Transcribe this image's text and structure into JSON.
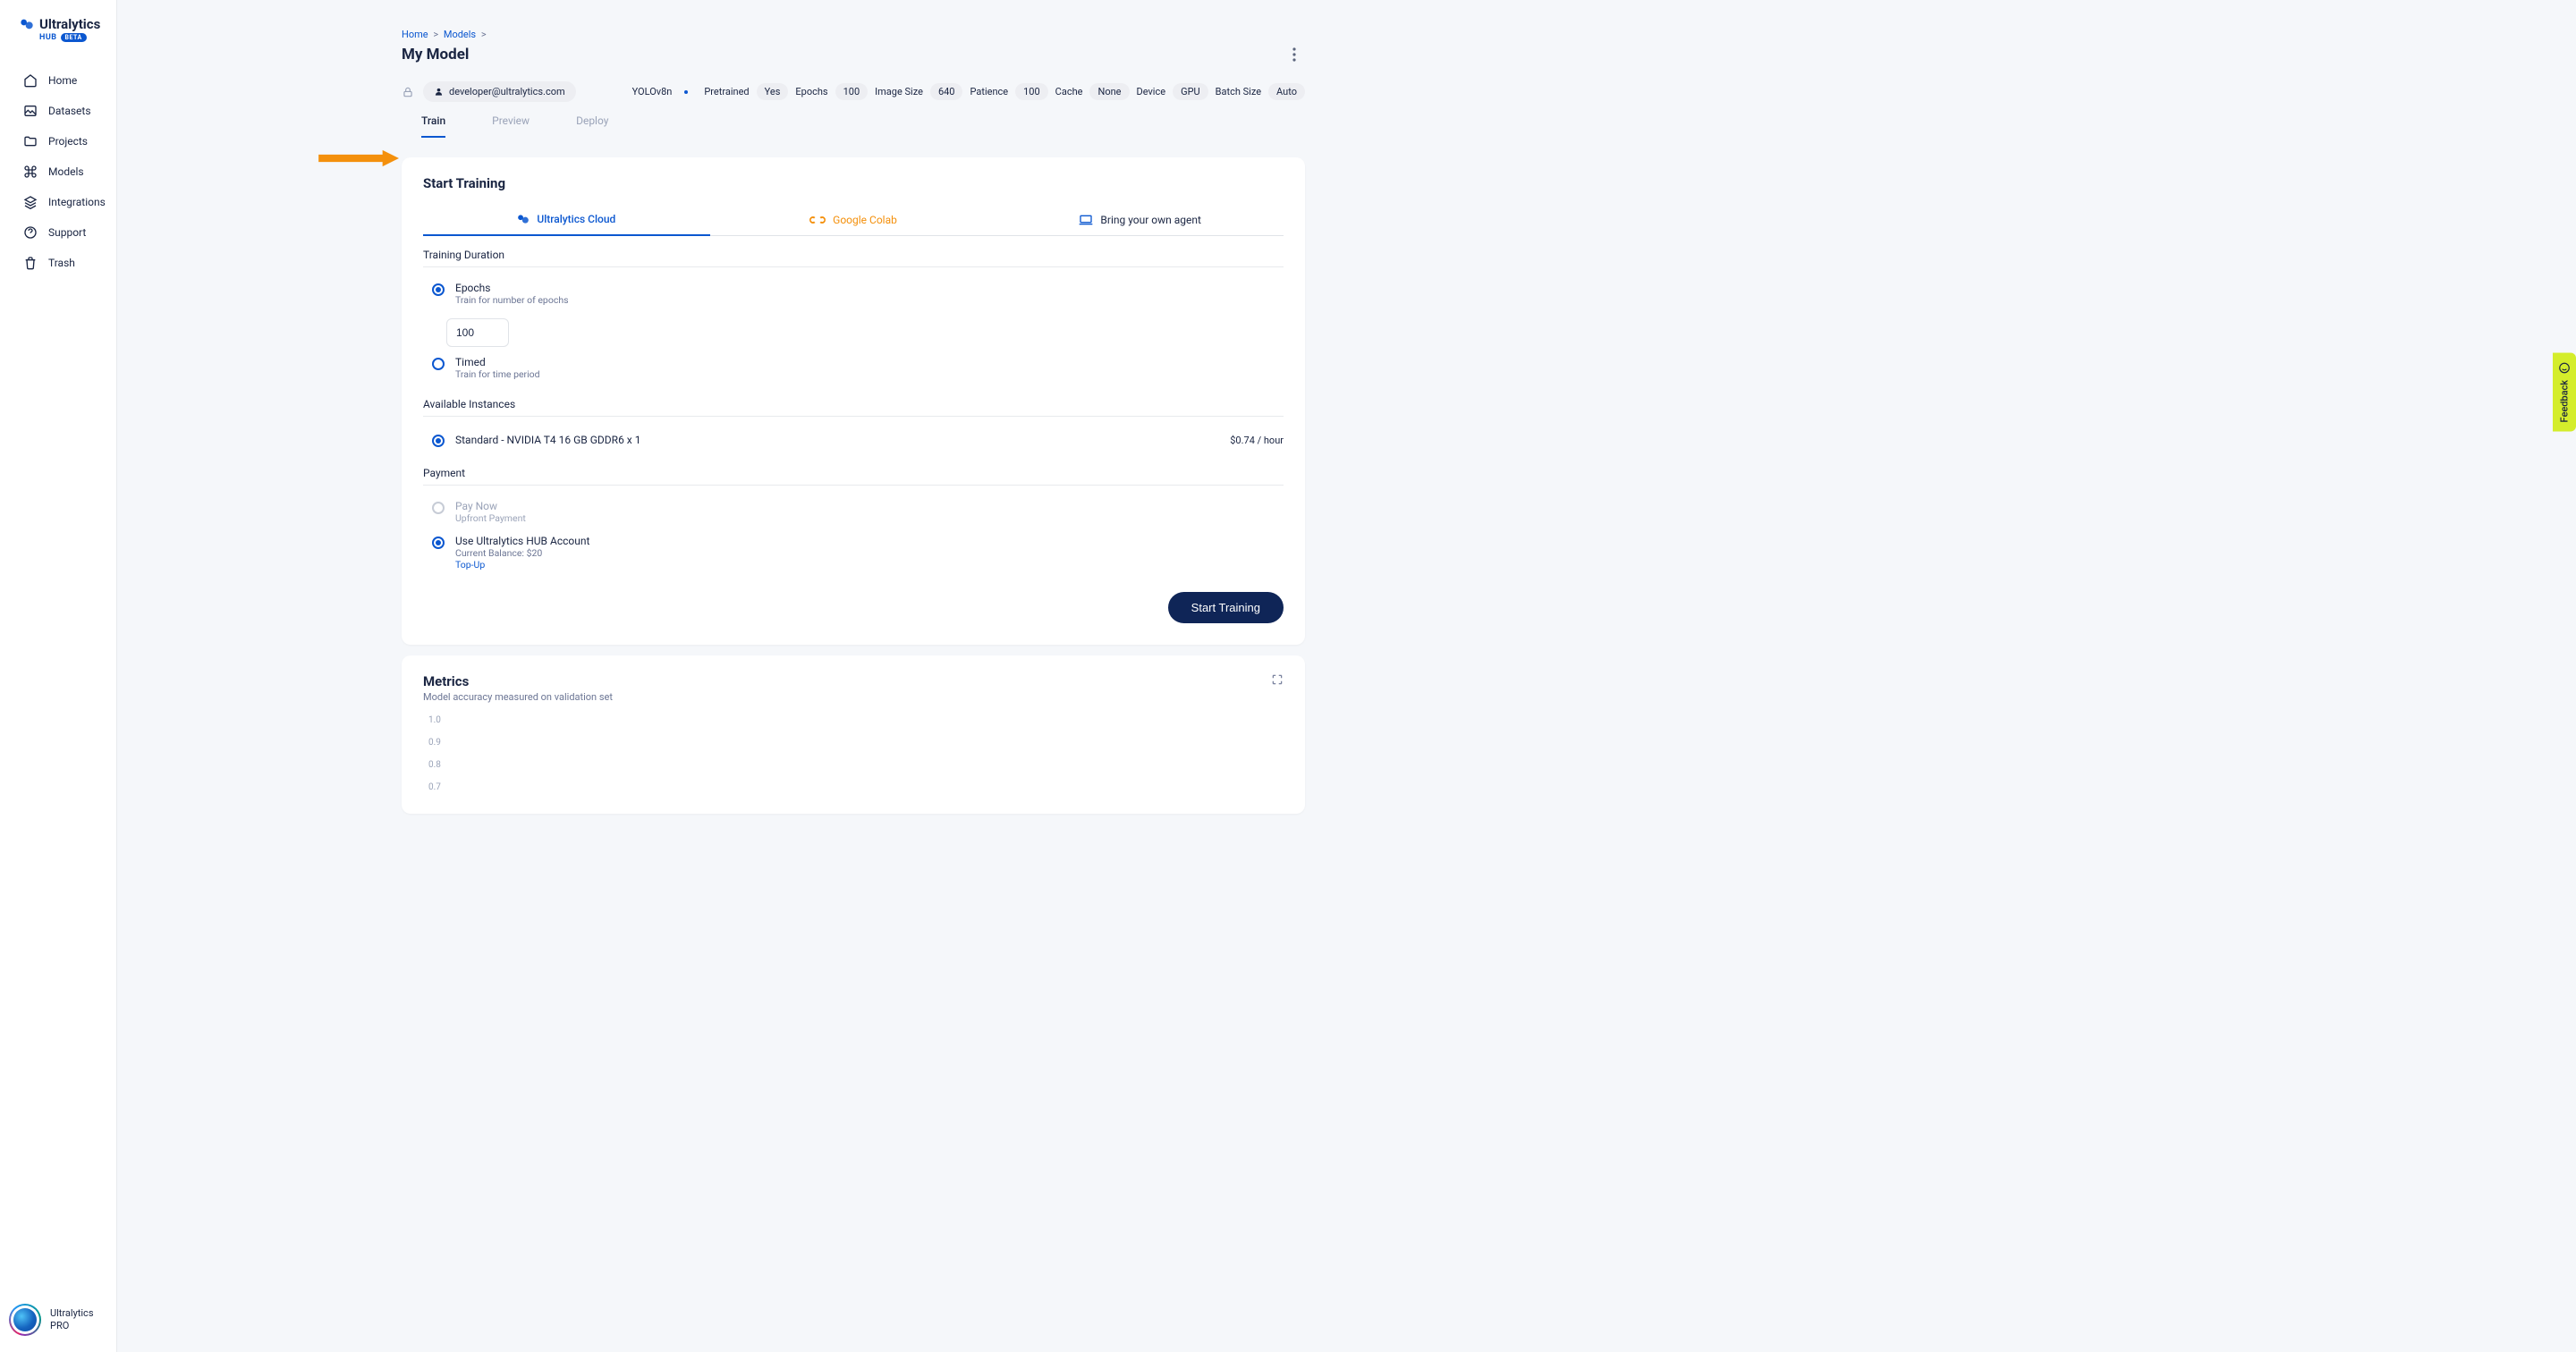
{
  "brand": {
    "name": "Ultralytics",
    "sub1": "HUB",
    "sub2": "BETA"
  },
  "sidebar": {
    "items": [
      {
        "label": "Home"
      },
      {
        "label": "Datasets"
      },
      {
        "label": "Projects"
      },
      {
        "label": "Models"
      },
      {
        "label": "Integrations"
      },
      {
        "label": "Support"
      },
      {
        "label": "Trash"
      }
    ],
    "footer_line1": "Ultralytics",
    "footer_line2": "PRO"
  },
  "breadcrumb": {
    "home": "Home",
    "models": "Models"
  },
  "page_title": "My Model",
  "user_email": "developer@ultralytics.com",
  "model_name": "YOLOv8n",
  "chips": [
    {
      "label": "Pretrained",
      "value": "Yes"
    },
    {
      "label": "Epochs",
      "value": "100"
    },
    {
      "label": "Image Size",
      "value": "640"
    },
    {
      "label": "Patience",
      "value": "100"
    },
    {
      "label": "Cache",
      "value": "None"
    },
    {
      "label": "Device",
      "value": "GPU"
    },
    {
      "label": "Batch Size",
      "value": "Auto"
    }
  ],
  "tabs": {
    "train": "Train",
    "preview": "Preview",
    "deploy": "Deploy"
  },
  "card": {
    "title": "Start Training",
    "train_tabs": {
      "cloud": "Ultralytics Cloud",
      "colab": "Google Colab",
      "byoa": "Bring your own agent"
    },
    "duration_label": "Training Duration",
    "epochs_title": "Epochs",
    "epochs_sub": "Train for number of epochs",
    "epochs_value": "100",
    "timed_title": "Timed",
    "timed_sub": "Train for time period",
    "instances_label": "Available Instances",
    "instance_name": "Standard - NVIDIA T4 16 GB GDDR6 x 1",
    "instance_price": "$0.74 / hour",
    "payment_label": "Payment",
    "paynow_title": "Pay Now",
    "paynow_sub": "Upfront Payment",
    "hubacct_title": "Use Ultralytics HUB Account",
    "hubacct_sub": "Current Balance: $20",
    "topup": "Top-Up",
    "start_btn": "Start Training"
  },
  "metrics": {
    "title": "Metrics",
    "sub": "Model accuracy measured on validation set",
    "ticks": [
      "1.0",
      "0.9",
      "0.8",
      "0.7"
    ]
  },
  "feedback": "Feedback"
}
